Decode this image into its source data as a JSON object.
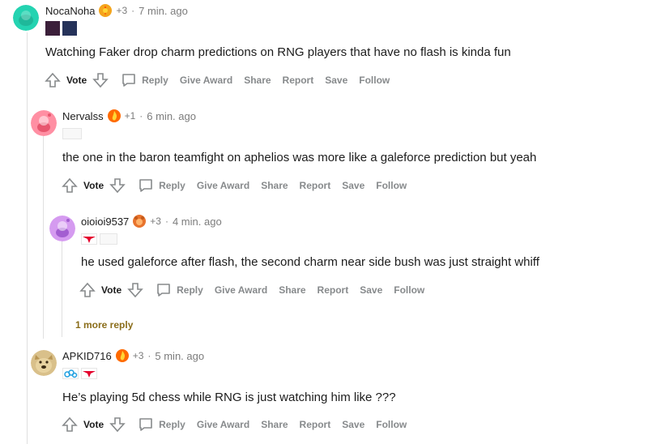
{
  "colors": {
    "accent_more_reply": "#8a6d1a",
    "text_muted": "#7c7c7c",
    "action_gray": "#878a8c"
  },
  "action_labels": {
    "vote": "Vote",
    "reply": "Reply",
    "give_award": "Give Award",
    "share": "Share",
    "report": "Report",
    "save": "Save",
    "follow": "Follow"
  },
  "comments": [
    {
      "username": "NocaNoha",
      "karma": "+3",
      "time": "7 min. ago",
      "body": "Watching Faker drop charm predictions on RNG players that have no flash is kinda fun",
      "avatar_icon": "snoo-teal-avatar-icon"
    },
    {
      "username": "Nervalss",
      "karma": "+1",
      "time": "6 min. ago",
      "body": "the one in the baron teamfight on aphelios was more like a galeforce prediction but yeah",
      "avatar_icon": "snoo-pink-avatar-icon"
    },
    {
      "username": "oioioi9537",
      "karma": "+3",
      "time": "4 min. ago",
      "body": "he used galeforce after flash, the second charm near side bush was just straight whiff",
      "avatar_icon": "snoo-purple-avatar-icon"
    },
    {
      "username": "APKID716",
      "karma": "+3",
      "time": "5 min. ago",
      "body": "He’s playing 5d chess while RNG is just watching him like ???",
      "avatar_icon": "doge-avatar-icon"
    }
  ],
  "more_reply": "1 more reply",
  "separator": "·"
}
